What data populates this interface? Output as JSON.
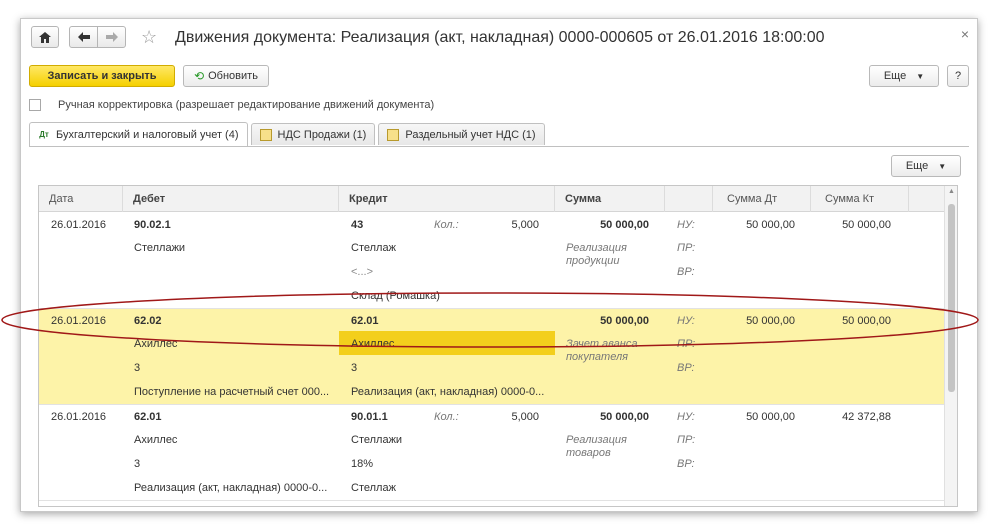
{
  "window": {
    "title": "Движения документа: Реализация (акт, накладная) 0000-000605 от 26.01.2016 18:00:00",
    "close": "×"
  },
  "toolbar": {
    "save_close": "Записать и закрыть",
    "refresh": "Обновить",
    "more": "Еще",
    "help": "?"
  },
  "manual_edit": {
    "label": "Ручная корректировка (разрешает редактирование движений документа)",
    "checked": false
  },
  "tabs": [
    {
      "label": "Бухгалтерский и налоговый учет (4)",
      "active": true,
      "icon": "accounting-icon"
    },
    {
      "label": "НДС Продажи (1)",
      "active": false,
      "icon": "register-icon"
    },
    {
      "label": "Раздельный учет НДС (1)",
      "active": false,
      "icon": "register-icon"
    }
  ],
  "table_more": "Еще",
  "table": {
    "headers": {
      "date": "Дата",
      "debit": "Дебет",
      "credit": "Кредит",
      "sum": "Сумма",
      "sum_dt": "Сумма Дт",
      "sum_kt": "Сумма Кт"
    },
    "rows": [
      {
        "date": "26.01.2016",
        "debit_account": "90.02.1",
        "debit_sub": [
          "Стеллажи",
          "",
          ""
        ],
        "credit_account": "43",
        "credit_sub": [
          "Стеллаж",
          "<...>",
          "Склад (Ромашка)"
        ],
        "qty_label": "Кол.:",
        "qty": "5,000",
        "sum": "50 000,00",
        "content": "Реализация продукции",
        "nu": "НУ:",
        "pr": "ПР:",
        "vr": "ВР:",
        "sum_dt": "50 000,00",
        "sum_kt": "50 000,00",
        "highlighted": false
      },
      {
        "date": "26.01.2016",
        "debit_account": "62.02",
        "debit_sub": [
          "Ахиллес",
          "3",
          "Поступление на расчетный счет 000..."
        ],
        "credit_account": "62.01",
        "credit_sub": [
          "Ахиллес",
          "3",
          "Реализация (акт, накладная) 0000-0..."
        ],
        "qty_label": "",
        "qty": "",
        "sum": "50 000,00",
        "content": "Зачет аванса покупателя",
        "nu": "НУ:",
        "pr": "ПР:",
        "vr": "ВР:",
        "sum_dt": "50 000,00",
        "sum_kt": "50 000,00",
        "highlighted": true
      },
      {
        "date": "26.01.2016",
        "debit_account": "62.01",
        "debit_sub": [
          "Ахиллес",
          "3",
          "Реализация (акт, накладная) 0000-0..."
        ],
        "credit_account": "90.01.1",
        "credit_sub": [
          "Стеллажи",
          "18%",
          "Стеллаж"
        ],
        "qty_label": "Кол.:",
        "qty": "5,000",
        "sum": "50 000,00",
        "content": "Реализация товаров",
        "nu": "НУ:",
        "pr": "ПР:",
        "vr": "ВР:",
        "sum_dt": "50 000,00",
        "sum_kt": "42 372,88",
        "highlighted": false
      }
    ]
  },
  "colors": {
    "highlight_row": "#fdf3a8",
    "selected_cell": "#f3cf1c",
    "primary_button": "#f5d000",
    "annotation_ellipse": "#a01818"
  }
}
